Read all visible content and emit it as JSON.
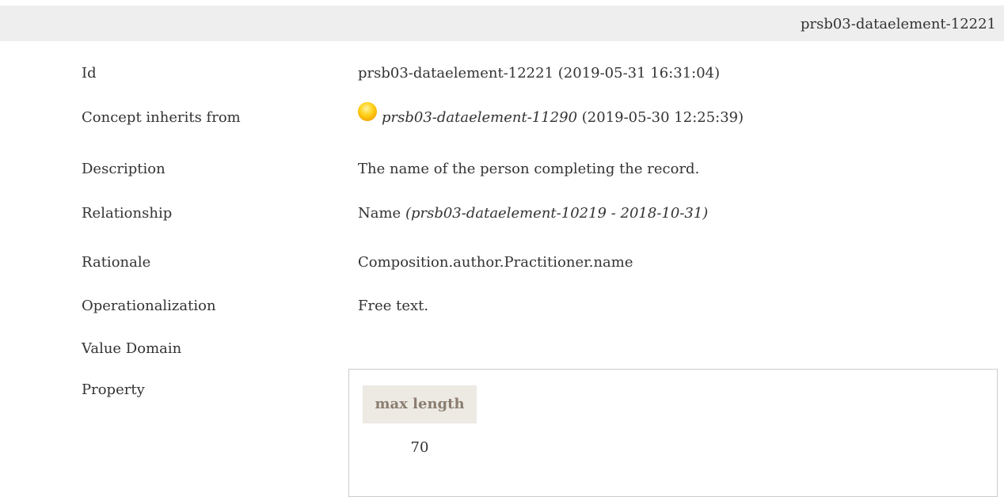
{
  "header": {
    "id_text": "prsb03-dataelement-12221"
  },
  "fields": {
    "id": {
      "label": "Id",
      "value": "prsb03-dataelement-12221 (2019-05-31 16:31:04)"
    },
    "inherits": {
      "label": "Concept inherits from",
      "ref": "prsb03-dataelement-11290",
      "date": " (2019-05-30 12:25:39)",
      "icon": "yellow-orb-icon"
    },
    "description": {
      "label": "Description",
      "value": "The name of the person completing the record."
    },
    "relationship": {
      "label": "Relationship",
      "name": "Name",
      "ref": "(prsb03-dataelement-10219 - 2018-10-31)"
    },
    "rationale": {
      "label": "Rationale",
      "value": "Composition.author.Practitioner.name"
    },
    "operationalization": {
      "label": "Operationalization",
      "value": "Free text."
    },
    "value_domain": {
      "label": "Value Domain"
    },
    "property": {
      "label": "Property",
      "column_header": "max length",
      "column_value": "70"
    }
  },
  "colors": {
    "topbar_bg": "#eeeeee",
    "property_header_bg": "#ede9e3",
    "property_header_text": "#8a7e70",
    "text": "#333333"
  }
}
